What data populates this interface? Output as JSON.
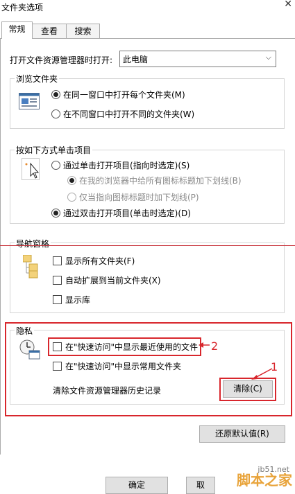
{
  "window": {
    "title": "文件夹选项"
  },
  "tabs": [
    {
      "label": "常规"
    },
    {
      "label": "查看"
    },
    {
      "label": "搜索"
    }
  ],
  "open_explorer": {
    "label": "打开文件资源管理器时打开:",
    "value": "此电脑"
  },
  "browse_folders": {
    "title": "浏览文件夹",
    "options": [
      {
        "label": "在同一窗口中打开每个文件夹(M)",
        "selected": true
      },
      {
        "label": "在不同窗口中打开不同的文件夹(W)",
        "selected": false
      }
    ]
  },
  "click_items": {
    "title": "按如下方式单击项目",
    "single_click": "通过单击打开项目(指向时选定)(S)",
    "underline_all": "在我的浏览器中给所有图标标题加下划线(B)",
    "underline_hover": "仅当指向图标标题时加下划线(P)",
    "double_click": "通过双击打开项目(单击时选定)(D)"
  },
  "nav_pane": {
    "title": "导航窗格",
    "show_all_folders": "显示所有文件夹(F)",
    "expand_to_current": "自动扩展到当前文件夹(X)",
    "show_libraries": "显示库"
  },
  "privacy": {
    "title": "隐私",
    "recent_files": "在\"快速访问\"中显示最近使用的文件",
    "frequent_folders": "在\"快速访问\"中显示常用文件夹",
    "clear_history_label": "清除文件资源管理器历史记录",
    "clear_button": "清除(C)"
  },
  "restore_defaults": "还原默认值(R)",
  "footer": {
    "ok": "确定",
    "cancel": "取"
  },
  "annotations": {
    "one": "1",
    "two": "2"
  },
  "watermark": {
    "url": "jb51.net",
    "text": "脚本之家"
  },
  "colors": {
    "annotation": "#d8262c",
    "accent": "#0078d7"
  }
}
